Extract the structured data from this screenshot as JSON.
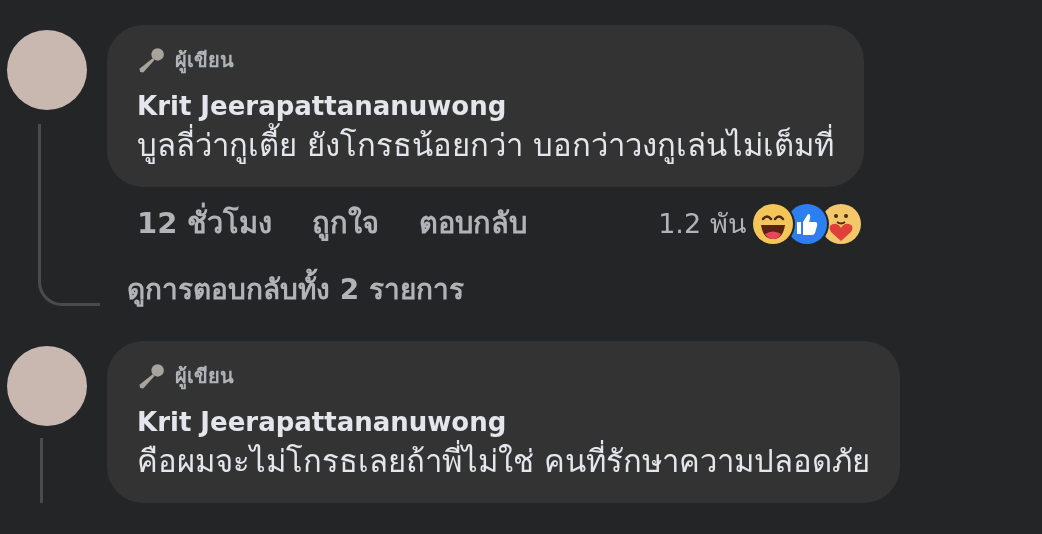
{
  "comments": [
    {
      "badge": "ผู้เขียน",
      "author": "Krit Jeerapattananuwong",
      "text": "บูลลี่ว่ากูเตี้ย ยังโกรธน้อยกว่า บอกว่าวงกูเล่นไม่เต็มที่",
      "time": "12 ชั่วโมง",
      "actions": [
        "ถูกใจ",
        "ตอบกลับ"
      ],
      "reaction_count": "1.2 พัน",
      "view_replies": "ดูการตอบกลับทั้ง 2 รายการ"
    },
    {
      "badge": "ผู้เขียน",
      "author": "Krit Jeerapattananuwong",
      "text": "คือผมจะไม่โกรธเลยถ้าพี่ไม่ใช่ คนที่รักษาความปลอดภัย"
    }
  ]
}
